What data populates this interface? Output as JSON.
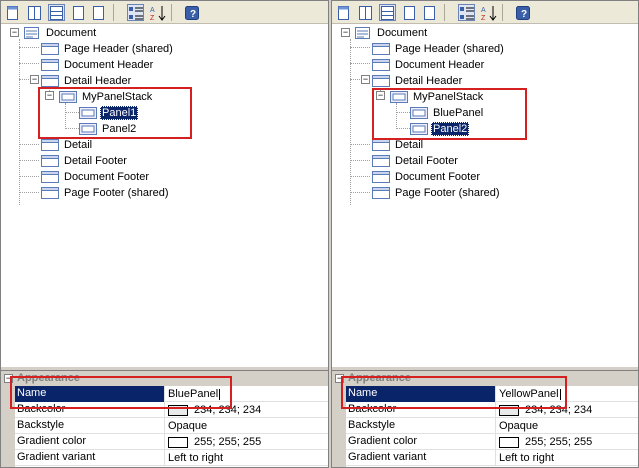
{
  "panes": [
    {
      "tree": {
        "root": "Document",
        "nodes": [
          "Page Header (shared)",
          "Document Header",
          "Detail Header",
          "MyPanelStack",
          "Panel1",
          "Panel2",
          "Detail",
          "Detail Footer",
          "Document Footer",
          "Page Footer (shared)"
        ],
        "selected": "Panel1"
      },
      "properties": {
        "category": "Appearance",
        "rows": [
          {
            "name": "Name",
            "value": "BluePanel"
          },
          {
            "name": "Backcolor",
            "value": "234; 234; 234",
            "swatch": "#eaeaea"
          },
          {
            "name": "Backstyle",
            "value": "Opaque"
          },
          {
            "name": "Gradient color",
            "value": "255; 255; 255",
            "swatch": "#ffffff"
          },
          {
            "name": "Gradient variant",
            "value": "Left to right"
          }
        ]
      }
    },
    {
      "tree": {
        "root": "Document",
        "nodes": [
          "Page Header (shared)",
          "Document Header",
          "Detail Header",
          "MyPanelStack",
          "BluePanel",
          "Panel2",
          "Detail",
          "Detail Footer",
          "Document Footer",
          "Page Footer (shared)"
        ],
        "selected": "Panel2"
      },
      "properties": {
        "category": "Appearance",
        "rows": [
          {
            "name": "Name",
            "value": "YellowPanel"
          },
          {
            "name": "Backcolor",
            "value": "234; 234; 234",
            "swatch": "#eaeaea"
          },
          {
            "name": "Backstyle",
            "value": "Opaque"
          },
          {
            "name": "Gradient color",
            "value": "255; 255; 255",
            "swatch": "#ffffff"
          },
          {
            "name": "Gradient variant",
            "value": "Left to right"
          }
        ]
      }
    }
  ],
  "colors": {
    "highlight": "#d42020",
    "selection": "#0a246a"
  },
  "icons": {
    "toolbar": [
      "section-icon",
      "columns-icon",
      "rows-icon",
      "page-icon",
      "blank-page-icon",
      "categorized-icon",
      "sort-az-icon",
      "property-pages-icon"
    ],
    "tree": [
      "document-icon",
      "section-icon",
      "panel-icon"
    ]
  }
}
